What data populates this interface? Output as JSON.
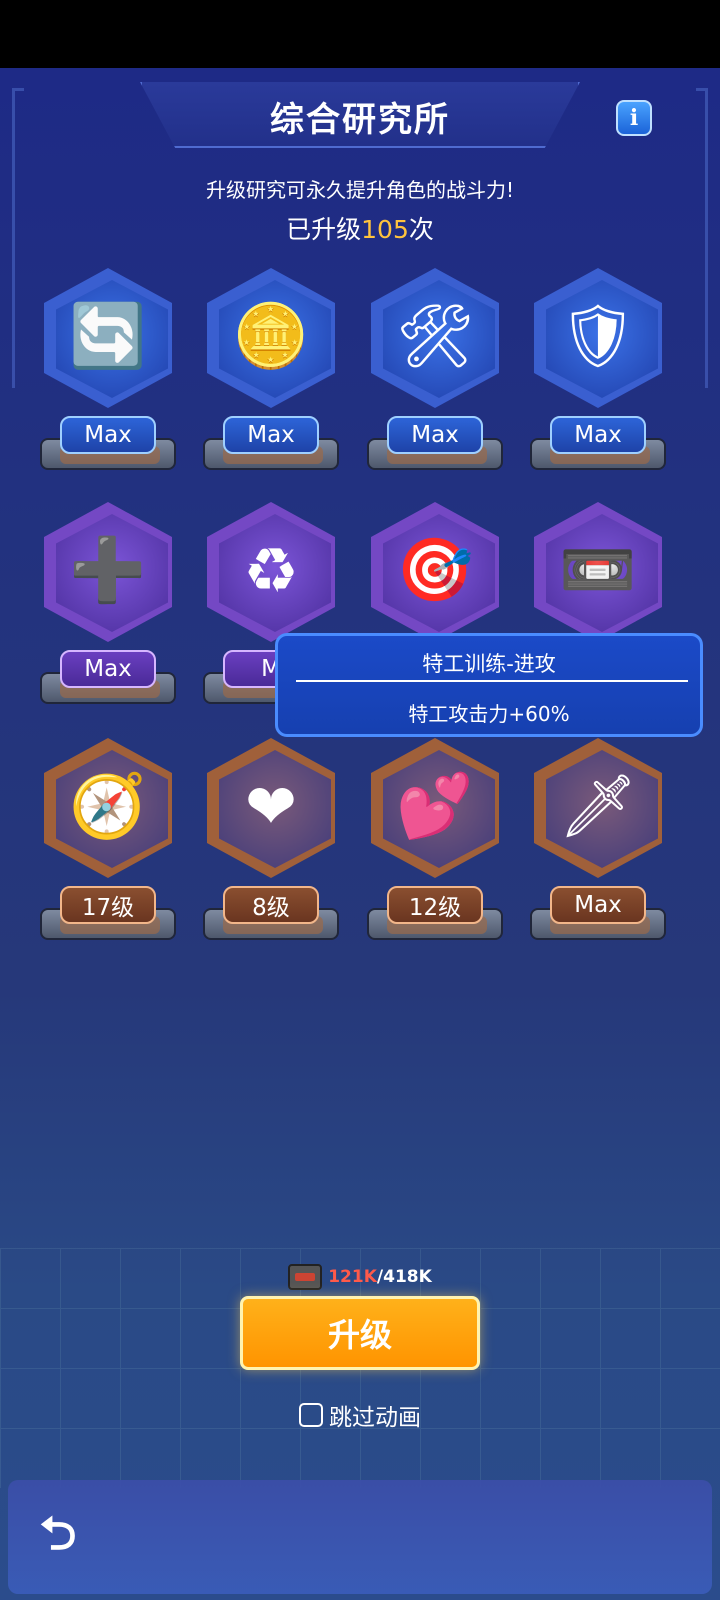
{
  "header": {
    "title": "综合研究所",
    "info_icon": "i",
    "subtitle": "升级研究可永久提升角色的战斗力!",
    "count_prefix": "已升级",
    "count_value": "105",
    "count_suffix": "次"
  },
  "research_items": [
    {
      "icon": "card-swap-icon",
      "glyph": "🔄",
      "level": "Max",
      "tier": "blue"
    },
    {
      "icon": "gold-coin-icon",
      "glyph": "🪙",
      "level": "Max",
      "tier": "blue"
    },
    {
      "icon": "tools-icon",
      "glyph": "🛠",
      "level": "Max",
      "tier": "blue"
    },
    {
      "icon": "shield-icon",
      "glyph": "🛡",
      "level": "Max",
      "tier": "blue"
    },
    {
      "icon": "gold-plus-coin-icon",
      "glyph": "➕",
      "level": "Max",
      "tier": "purple"
    },
    {
      "icon": "recycle-icon",
      "glyph": "♻",
      "level": "M",
      "tier": "purple"
    },
    {
      "icon": "target-card-icon",
      "glyph": "🎯",
      "level": "",
      "tier": "purple"
    },
    {
      "icon": "tape-plus-icon",
      "glyph": "📼",
      "level": "",
      "tier": "purple"
    },
    {
      "icon": "radar-icon",
      "glyph": "🧭",
      "level": "17级",
      "tier": "orange"
    },
    {
      "icon": "heart-up-icon",
      "glyph": "❤",
      "level": "8级",
      "tier": "orange"
    },
    {
      "icon": "hearts-plus-icon",
      "glyph": "💕",
      "level": "12级",
      "tier": "orange"
    },
    {
      "icon": "sword-up-icon",
      "glyph": "🗡",
      "level": "Max",
      "tier": "orange"
    }
  ],
  "tooltip": {
    "title": "特工训练-进攻",
    "body": "特工攻击力+60%"
  },
  "resource": {
    "icon": "cassette-tape-icon",
    "current": "121K",
    "separator": "/",
    "max": "418K"
  },
  "upgrade_button": "升级",
  "skip_animation": "跳过动画",
  "back_icon": "back-arrow-icon",
  "back_glyph": "⮌"
}
